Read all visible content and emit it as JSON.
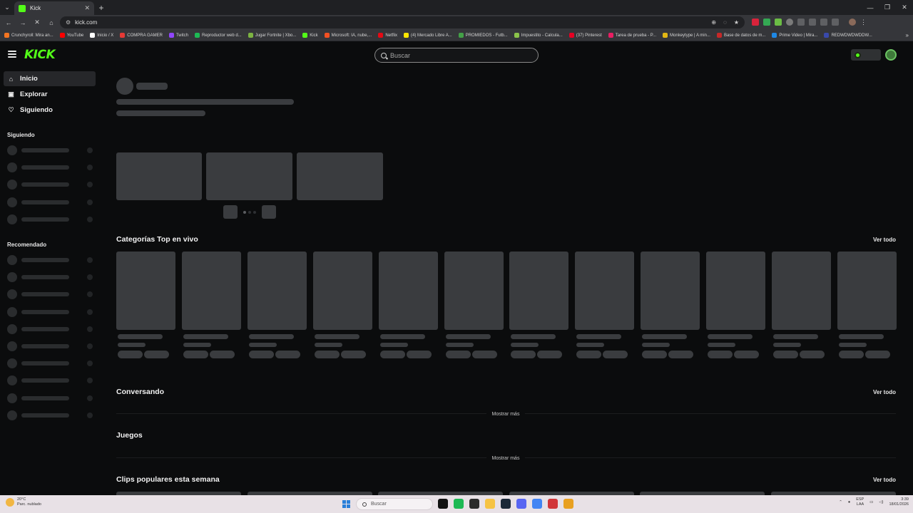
{
  "browser": {
    "tab_title": "Kick",
    "url": "kick.com",
    "bookmarks": [
      {
        "label": "Crunchyroll: Mira an...",
        "color": "#f47521"
      },
      {
        "label": "YouTube",
        "color": "#ff0000"
      },
      {
        "label": "Inicio / X",
        "color": "#ffffff"
      },
      {
        "label": "COMPRA GAMER",
        "color": "#e53935"
      },
      {
        "label": "Twitch",
        "color": "#9146ff"
      },
      {
        "label": "Reproductor web d...",
        "color": "#1db954"
      },
      {
        "label": "Jugar Fortnite | Xbo...",
        "color": "#7cb342"
      },
      {
        "label": "Kick",
        "color": "#53fc18"
      },
      {
        "label": "Microsoft: IA, nube,...",
        "color": "#f25022"
      },
      {
        "label": "Netflix",
        "color": "#e50914"
      },
      {
        "label": "(4) Mercado Libre A...",
        "color": "#ffe600"
      },
      {
        "label": "PROMIEDOS - Futb...",
        "color": "#43a047"
      },
      {
        "label": "Impuestito - Calcula...",
        "color": "#8bc34a"
      },
      {
        "label": "(37) Pinterest",
        "color": "#e60023"
      },
      {
        "label": "Tarea de prueba - P...",
        "color": "#e91e63"
      },
      {
        "label": "Monkeytype | A min...",
        "color": "#e2b714"
      },
      {
        "label": "Base de datos de m...",
        "color": "#c62828"
      },
      {
        "label": "Prime Video | Mira...",
        "color": "#1e88e5"
      },
      {
        "label": "REDWDWDWDDW...",
        "color": "#3949ab"
      }
    ]
  },
  "kick": {
    "logo": "KICK",
    "search_placeholder": "Buscar",
    "nav": [
      {
        "label": "Inicio",
        "icon": "home-icon"
      },
      {
        "label": "Explorar",
        "icon": "compass-icon"
      },
      {
        "label": "Siguiendo",
        "icon": "heart-icon"
      }
    ],
    "siguiendo_heading": "Siguiendo",
    "recomendado_heading": "Recomendado",
    "sections": {
      "top_categories": "Categorías Top en vivo",
      "conversando": "Conversando",
      "juegos": "Juegos",
      "clips": "Clips populares esta semana",
      "ver_todo": "Ver todo",
      "mostrar_mas": "Mostrar más"
    }
  },
  "taskbar": {
    "weather_temp": "20°C",
    "weather_desc": "Parc. nublado",
    "search_placeholder": "Buscar",
    "lang_top": "ESP",
    "lang_bottom": "LAA",
    "time": "3:39",
    "date": "18/01/2026",
    "apps": [
      {
        "name": "chatgpt-icon",
        "color": "#111111"
      },
      {
        "name": "spotify-icon",
        "color": "#1db954"
      },
      {
        "name": "epic-games-icon",
        "color": "#2b2b2b"
      },
      {
        "name": "file-explorer-icon",
        "color": "#f6c343"
      },
      {
        "name": "steam-icon",
        "color": "#1b2838"
      },
      {
        "name": "discord-icon",
        "color": "#5865f2"
      },
      {
        "name": "chrome-icon",
        "color": "#4285f4"
      },
      {
        "name": "riot-icon",
        "color": "#d13639"
      },
      {
        "name": "marvel-rivals-icon",
        "color": "#e8a020"
      }
    ]
  }
}
